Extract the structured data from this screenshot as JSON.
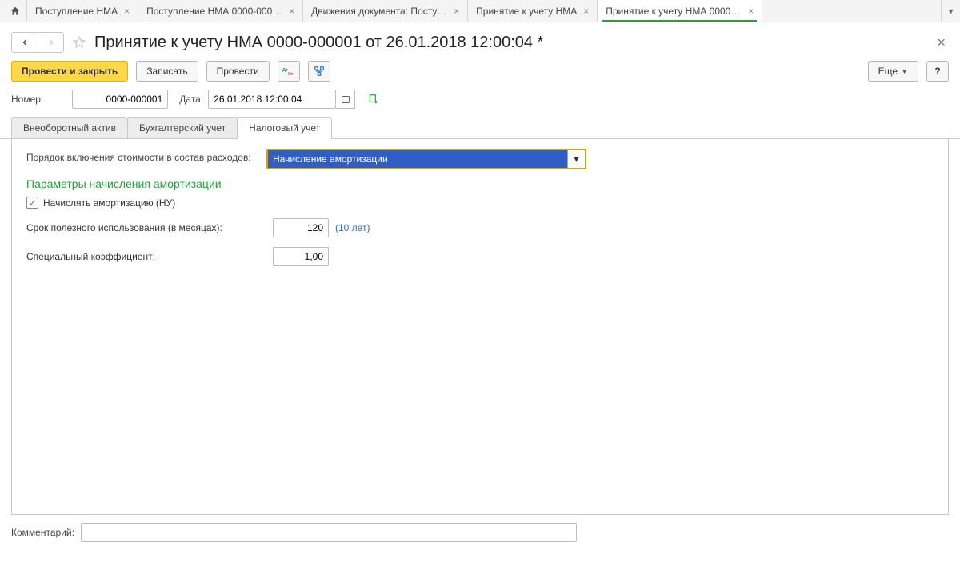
{
  "tabs": [
    {
      "label": "Поступление НМА"
    },
    {
      "label": "Поступление НМА 0000-000001 от 2..."
    },
    {
      "label": "Движения документа: Поступление ..."
    },
    {
      "label": "Принятие к учету НМА"
    },
    {
      "label": "Принятие к учету НМА 0000-000001...",
      "active": true
    }
  ],
  "header": {
    "title": "Принятие к учету НМА 0000-000001 от 26.01.2018 12:00:04 *"
  },
  "toolbar": {
    "post_close": "Провести и закрыть",
    "save": "Записать",
    "post": "Провести",
    "more": "Еще",
    "help": "?"
  },
  "fields": {
    "number_label": "Номер:",
    "number_value": "0000-000001",
    "date_label": "Дата:",
    "date_value": "26.01.2018 12:00:04"
  },
  "inner_tabs": [
    {
      "label": "Внеоборотный актив"
    },
    {
      "label": "Бухгалтерский учет"
    },
    {
      "label": "Налоговый учет",
      "active": true
    }
  ],
  "tax_form": {
    "order_label": "Порядок включения стоимости в состав расходов:",
    "order_value": "Начисление амортизации",
    "section_title": "Параметры начисления амортизации",
    "amort_checkbox_label": "Начислять амортизацию (НУ)",
    "amort_checked": true,
    "life_label": "Срок полезного использования (в месяцах):",
    "life_value": "120",
    "life_hint": "(10 лет)",
    "coef_label": "Специальный коэффициент:",
    "coef_value": "1,00"
  },
  "footer": {
    "comment_label": "Комментарий:",
    "comment_value": ""
  }
}
